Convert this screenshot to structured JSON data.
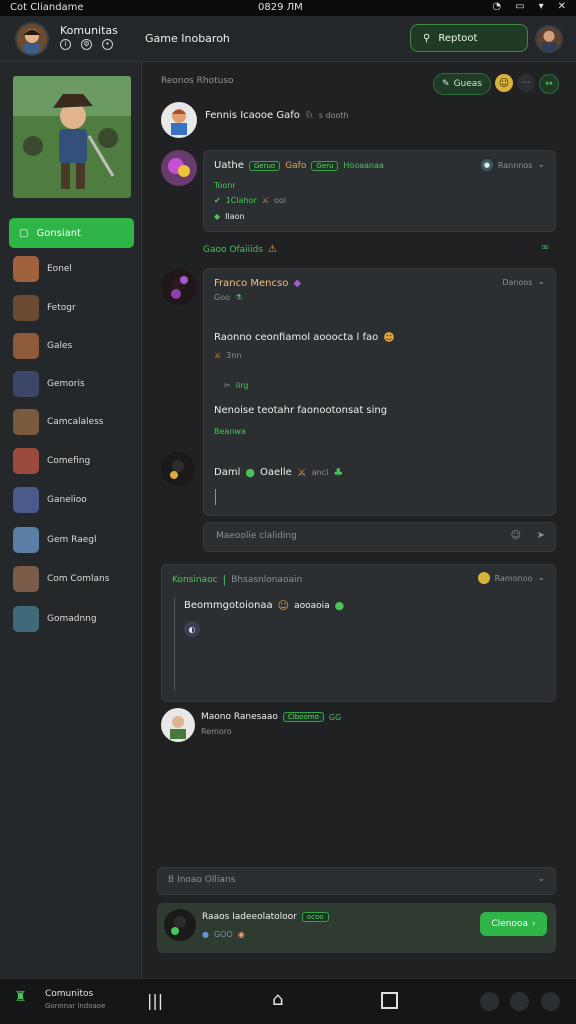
{
  "status_bar": {
    "carrier": "Cot Cliandame",
    "time": "0829 ЛМ"
  },
  "header": {
    "title": "Komunitas",
    "center_title": "Game Inobaroh",
    "search_label": "Reptoot"
  },
  "sidebar": {
    "active_label": "Gonsiant",
    "items": [
      {
        "label": "Eonel"
      },
      {
        "label": "Fetogr"
      },
      {
        "label": "Gales"
      },
      {
        "label": "Gemoris"
      },
      {
        "label": "Camcalaless"
      },
      {
        "label": "Comefing"
      },
      {
        "label": "Ganelioo"
      },
      {
        "label": "Gem Raegl"
      },
      {
        "label": "Com Comlans"
      },
      {
        "label": "Gomadnng"
      }
    ]
  },
  "main": {
    "section_label": "Reonos Rhotuso",
    "top_actions": {
      "pill_label": "Gueas"
    },
    "post1": {
      "name": "Fennis Icaooe Gafo",
      "sub": "s dooth"
    },
    "card1": {
      "name": "Uathe",
      "tag1": "Geruo",
      "label2": "Gafo",
      "tag2": "Geru",
      "tag2_text": "Hooaanaa",
      "status": "Rannnos",
      "line1": "Toonr",
      "line2": "1Clahor",
      "line2b": "ooi",
      "line3": "Ilaon"
    },
    "divider": {
      "label": "Gaoo Ofaiiids"
    },
    "card2": {
      "name": "Franco Mencso",
      "status": "Danoos",
      "sub": "Goo",
      "msg1": "Raonno ceonfiamol aooocta l fao",
      "msg1_sub": "3nn",
      "tool_label": "Iirg",
      "msg2": "Nenoise teotahr faonootonsat sing",
      "msg2_sub": "Beanwa",
      "row3_name": "Daml",
      "row3_text": "Oaelle",
      "row3_num": "ancl"
    },
    "input_placeholder": "Maeoolie claliding",
    "card3": {
      "title": "Konsinaoc",
      "title2": "Bhsasnlonaoain",
      "status": "Ramonoo",
      "line": "Beommgotoionaa",
      "line_suffix": "aooaoia"
    },
    "post2": {
      "name": "Maono Ranesaao",
      "tag": "Ciboomo",
      "tag2": "GG",
      "sub": "Remoro"
    },
    "filter": {
      "label": "B Inoao Ollians"
    },
    "bottom_card": {
      "name": "Raaos Iadeeolatoloor",
      "tag": "ocoo",
      "sub": "GOO",
      "button": "Clenooa"
    }
  },
  "bottom_nav": {
    "title": "Comunitos",
    "subtitle": "Gonnnar lndoaoe"
  },
  "colors": {
    "accent": "#2fb447",
    "background": "#1f2123",
    "card": "#2b2f32"
  }
}
